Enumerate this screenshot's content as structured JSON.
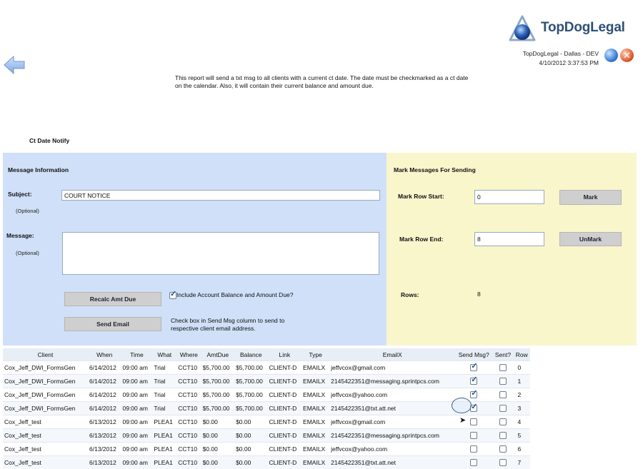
{
  "header": {
    "logo_text": "TopDogLegal",
    "env_line": "TopDogLegal - Dallas - DEV",
    "datetime": "4/10/2012 3:37:53 PM",
    "close_glyph": "✕"
  },
  "description": "This report will send a txt msg to all clients with a current ct date. The date must be checkmarked as a ct date on the calendar. Also, it will contain their current balance and amount due.",
  "section_title": "Ct Date Notify",
  "message_info": {
    "title": "Message Information",
    "subject_label": "Subject:",
    "subject_value": "COURT NOTICE",
    "optional": "(Optional)",
    "message_label": "Message:",
    "recalc_label": "Recalc Amt Due",
    "include_label": "Include Account Balance and Amount Due?",
    "send_label": "Send Email",
    "send_help": "Check box in Send Msg column to send to respective client email address."
  },
  "mark_messages": {
    "title": "Mark Messages For Sending",
    "row_start_label": "Mark Row Start:",
    "row_start_value": "0",
    "row_end_label": "Mark Row End:",
    "row_end_value": "8",
    "mark_label": "Mark",
    "unmark_label": "UnMark",
    "rows_label": "Rows:",
    "rows_value": "8"
  },
  "table": {
    "columns": [
      "Client",
      "When",
      "Time",
      "What",
      "Where",
      "AmtDue",
      "Balance",
      "Link",
      "Type",
      "EmailX",
      "Send Msg?",
      "Sent?",
      "Row"
    ],
    "rows": [
      {
        "client": "Cox_Jeff_DWI_FormsGen",
        "when": "6/14/2012",
        "time": "09:00 am",
        "what": "Trial",
        "where": "CCT10",
        "amt": "$5,700.00",
        "bal": "$5,700.00",
        "link": "CLIENT-D",
        "type": "EMAILX",
        "email": "jeffvcox@gmail.com",
        "send": true,
        "sent": false,
        "row": "0"
      },
      {
        "client": "Cox_Jeff_DWI_FormsGen",
        "when": "6/14/2012",
        "time": "09:00 am",
        "what": "Trial",
        "where": "CCT10",
        "amt": "$5,700.00",
        "bal": "$5,700.00",
        "link": "CLIENT-D",
        "type": "EMAILX",
        "email": "2145422351@messaging.sprintpcs.com",
        "send": true,
        "sent": false,
        "row": "1"
      },
      {
        "client": "Cox_Jeff_DWI_FormsGen",
        "when": "6/14/2012",
        "time": "09:00 am",
        "what": "Trial",
        "where": "CCT10",
        "amt": "$5,700.00",
        "bal": "$5,700.00",
        "link": "CLIENT-D",
        "type": "EMAILX",
        "email": "jeffvcox@yahoo.com",
        "send": true,
        "sent": false,
        "row": "2"
      },
      {
        "client": "Cox_Jeff_DWI_FormsGen",
        "when": "6/14/2012",
        "time": "09:00 am",
        "what": "Trial",
        "where": "CCT10",
        "amt": "$5,700.00",
        "bal": "$5,700.00",
        "link": "CLIENT-D",
        "type": "EMAILX",
        "email": "2145422351@txt.att.net",
        "send": true,
        "sent": false,
        "row": "3"
      },
      {
        "client": "Cox_Jeff_test",
        "when": "6/13/2012",
        "time": "09:00 am",
        "what": "PLEA1",
        "where": "CCT10",
        "amt": "$0.00",
        "bal": "$0.00",
        "link": "CLIENT-D",
        "type": "EMAILX",
        "email": "jeffvcox@gmail.com",
        "send": false,
        "sent": false,
        "row": "4"
      },
      {
        "client": "Cox_Jeff_test",
        "when": "6/13/2012",
        "time": "09:00 am",
        "what": "PLEA1",
        "where": "CCT10",
        "amt": "$0.00",
        "bal": "$0.00",
        "link": "CLIENT-D",
        "type": "EMAILX",
        "email": "2145422351@messaging.sprintpcs.com",
        "send": false,
        "sent": false,
        "row": "5"
      },
      {
        "client": "Cox_Jeff_test",
        "when": "6/13/2012",
        "time": "09:00 am",
        "what": "PLEA1",
        "where": "CCT10",
        "amt": "$0.00",
        "bal": "$0.00",
        "link": "CLIENT-D",
        "type": "EMAILX",
        "email": "jeffvcox@yahoo.com",
        "send": false,
        "sent": false,
        "row": "6"
      },
      {
        "client": "Cox_Jeff_test",
        "when": "6/13/2012",
        "time": "09:00 am",
        "what": "PLEA1",
        "where": "CCT10",
        "amt": "$0.00",
        "bal": "$0.00",
        "link": "CLIENT-D",
        "type": "EMAILX",
        "email": "2145422351@txt.att.net",
        "send": false,
        "sent": false,
        "row": "7"
      }
    ]
  },
  "icons": {
    "back": "back-arrow-icon",
    "info": "info-icon",
    "close": "close-icon",
    "logo": "logo-icon"
  },
  "colors": {
    "left_panel": "#cfe0f8",
    "right_panel": "#f9f6cc",
    "brand": "#2f4f78"
  }
}
